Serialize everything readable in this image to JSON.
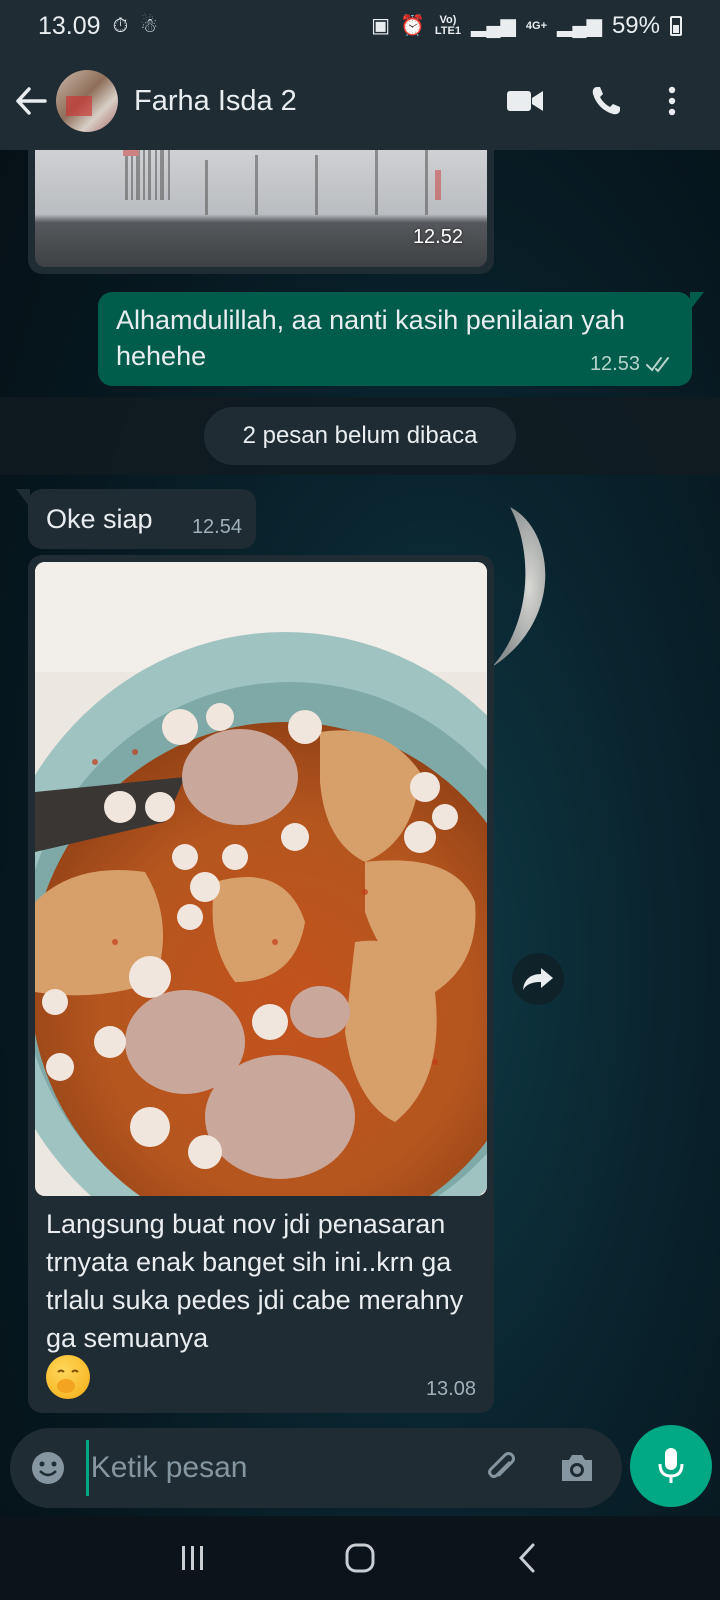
{
  "status_bar": {
    "time": "13.09",
    "network_label_1": "Vo)",
    "network_label_2": "LTE1",
    "network_4g": "4G+",
    "battery": "59%"
  },
  "header": {
    "contact_name": "Farha Isda 2"
  },
  "messages": [
    {
      "direction": "in",
      "type": "image",
      "time": "12.52"
    },
    {
      "direction": "out",
      "type": "text",
      "text": "Alhamdulillah, aa nanti kasih penilaian yah hehehe",
      "time": "12.53",
      "status": "read"
    },
    {
      "direction": "in",
      "type": "text",
      "text": "Oke siap",
      "time": "12.54"
    },
    {
      "direction": "in",
      "type": "image",
      "caption": "Langsung buat nov jdi penasaran trnyata enak banget sih ini..krn ga trlalu suka pedes jdi cabe merahny ga semuanya",
      "emoji": "face-with-hand-over-mouth",
      "time": "13.08"
    }
  ],
  "unread_banner": "2 pesan belum dibaca",
  "composer": {
    "placeholder": "Ketik pesan"
  },
  "icons": {
    "back": "back-arrow-icon",
    "video": "video-call-icon",
    "call": "phone-icon",
    "menu": "more-vertical-icon",
    "emoji": "emoji-icon",
    "attach": "attach-icon",
    "camera": "camera-icon",
    "mic": "mic-icon",
    "forward": "forward-icon"
  },
  "colors": {
    "header": "#1f2c34",
    "incoming_bubble": "#202c33",
    "outgoing_bubble": "#005c4b",
    "accent": "#00a884"
  }
}
